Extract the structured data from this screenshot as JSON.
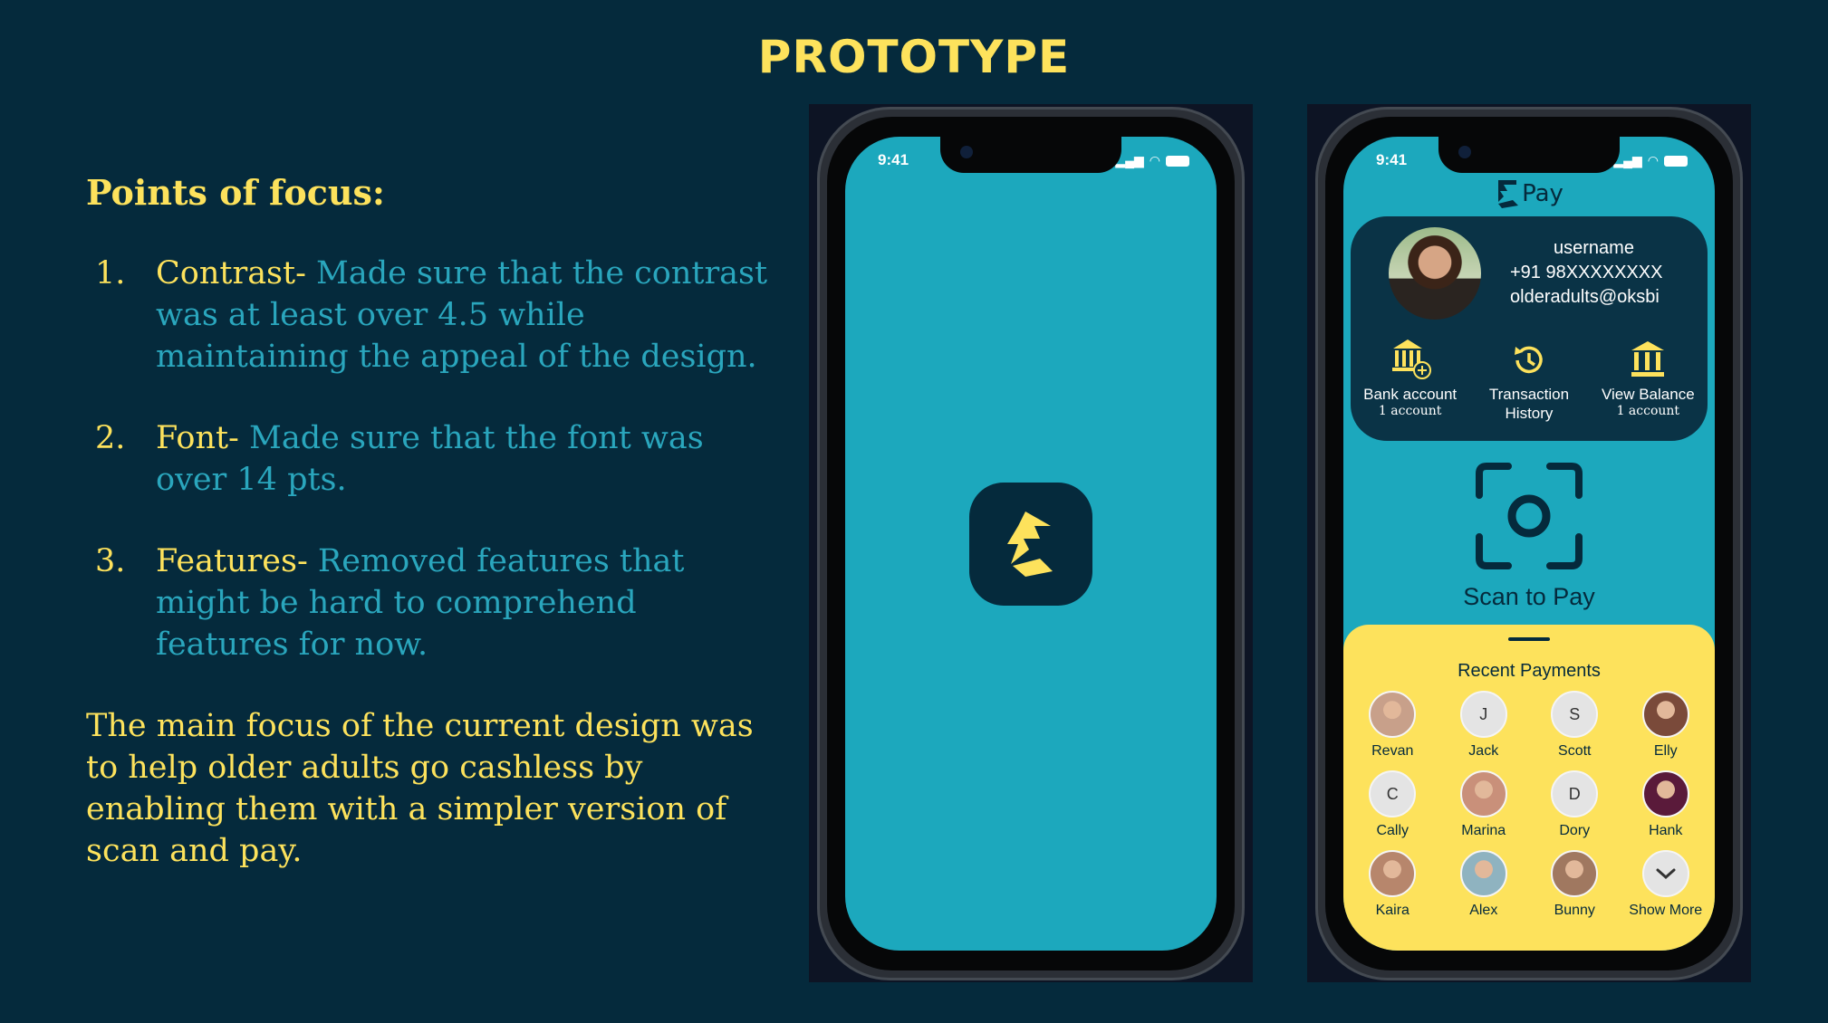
{
  "slide": {
    "title": "PROTOTYPE"
  },
  "notes": {
    "heading": "Points of focus:",
    "points": [
      {
        "num": "1.",
        "label": "Contrast- ",
        "desc": "Made sure that the contrast was at least over 4.5 while maintaining the appeal of the design."
      },
      {
        "num": "2.",
        "label": "Font- ",
        "desc": "Made sure that the font was over 14 pts."
      },
      {
        "num": "3.",
        "label": "Features- ",
        "desc": "Removed features that might be  hard to comprehend features for now."
      }
    ],
    "summary": "The main focus of the current design was to help older adults go cashless by enabling them with a simpler version of scan and pay."
  },
  "splash_phone": {
    "time": "9:41"
  },
  "pay_phone": {
    "time": "9:41",
    "brand": "Pay",
    "profile": {
      "username": "username",
      "phone": "+91 98XXXXXXXX",
      "email": "olderadults@oksbi"
    },
    "actions": [
      {
        "label": "Bank account",
        "sub": "1 account",
        "icon": "bank-add-icon"
      },
      {
        "label": "Transaction",
        "label2": "History",
        "icon": "history-icon"
      },
      {
        "label": "View Balance",
        "sub": "1 account",
        "icon": "bank-icon"
      }
    ],
    "scan_label": "Scan to Pay",
    "recent_title": "Recent Payments",
    "contacts": [
      {
        "name": "Revan",
        "initial": "",
        "photo": true
      },
      {
        "name": "Jack",
        "initial": "J"
      },
      {
        "name": "Scott",
        "initial": "S"
      },
      {
        "name": "Elly",
        "initial": "",
        "photo": true
      },
      {
        "name": "Cally",
        "initial": "C"
      },
      {
        "name": "Marina",
        "initial": "",
        "photo": true
      },
      {
        "name": "Dory",
        "initial": "D"
      },
      {
        "name": "Hank",
        "initial": "",
        "photo": true
      },
      {
        "name": "Kaira",
        "initial": "",
        "photo": true
      },
      {
        "name": "Alex",
        "initial": "",
        "photo": true
      },
      {
        "name": "Bunny",
        "initial": "",
        "photo": true
      },
      {
        "name": "Show More",
        "initial": "",
        "icon": "chevron-down-icon"
      }
    ]
  },
  "colors": {
    "background": "#052a3c",
    "accent_yellow": "#fde25c",
    "teal": "#1ca8bd",
    "desc_teal": "#2aa6bd"
  }
}
